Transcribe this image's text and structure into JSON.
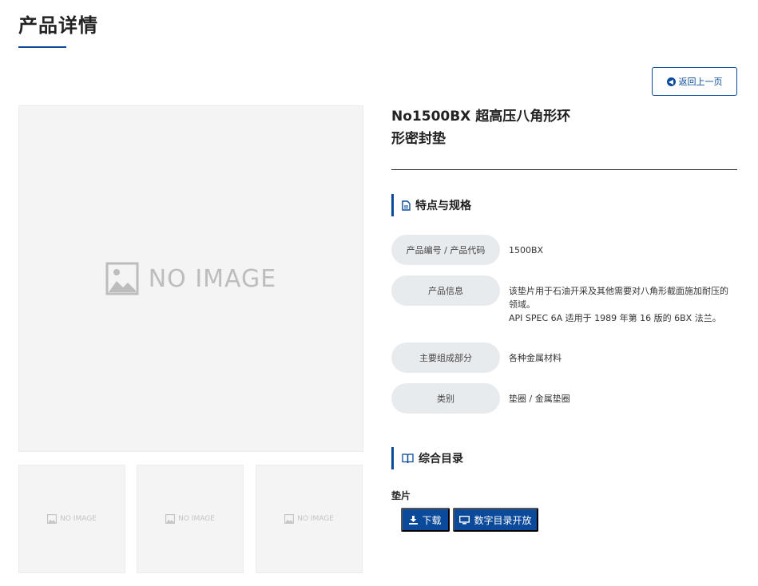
{
  "header": {
    "title": "产品详情"
  },
  "back_button": {
    "label": "返回上一页"
  },
  "gallery": {
    "main_placeholder": "NO IMAGE",
    "thumbnails": [
      "NO IMAGE",
      "NO IMAGE",
      "NO IMAGE"
    ]
  },
  "product": {
    "name_line1": "No1500BX 超高压八角形环",
    "name_line2": "形密封垫"
  },
  "specs": {
    "heading": "特点与规格",
    "rows": [
      {
        "label": "产品编号 / 产品代码",
        "value": "1500BX"
      },
      {
        "label": "产品信息",
        "value_line1": "该垫片用于石油开采及其他需要对八角形截面施加耐压的",
        "value_line2": "领域。",
        "value_line3": "API SPEC 6A 适用于 1989 年第 16 版的 6BX 法兰。"
      },
      {
        "label": "主要组成部分",
        "value": "各种金属材料"
      },
      {
        "label": "类别",
        "value": "垫圈 / 金属垫圈"
      }
    ]
  },
  "catalog": {
    "heading": "综合目录",
    "item_label": "垫片",
    "download_label": "下载",
    "digital_label": "数字目录开放"
  },
  "colors": {
    "accent": "#0b4a9b",
    "pill_bg": "#e8ebee",
    "placeholder_bg": "#f4f4f4"
  }
}
